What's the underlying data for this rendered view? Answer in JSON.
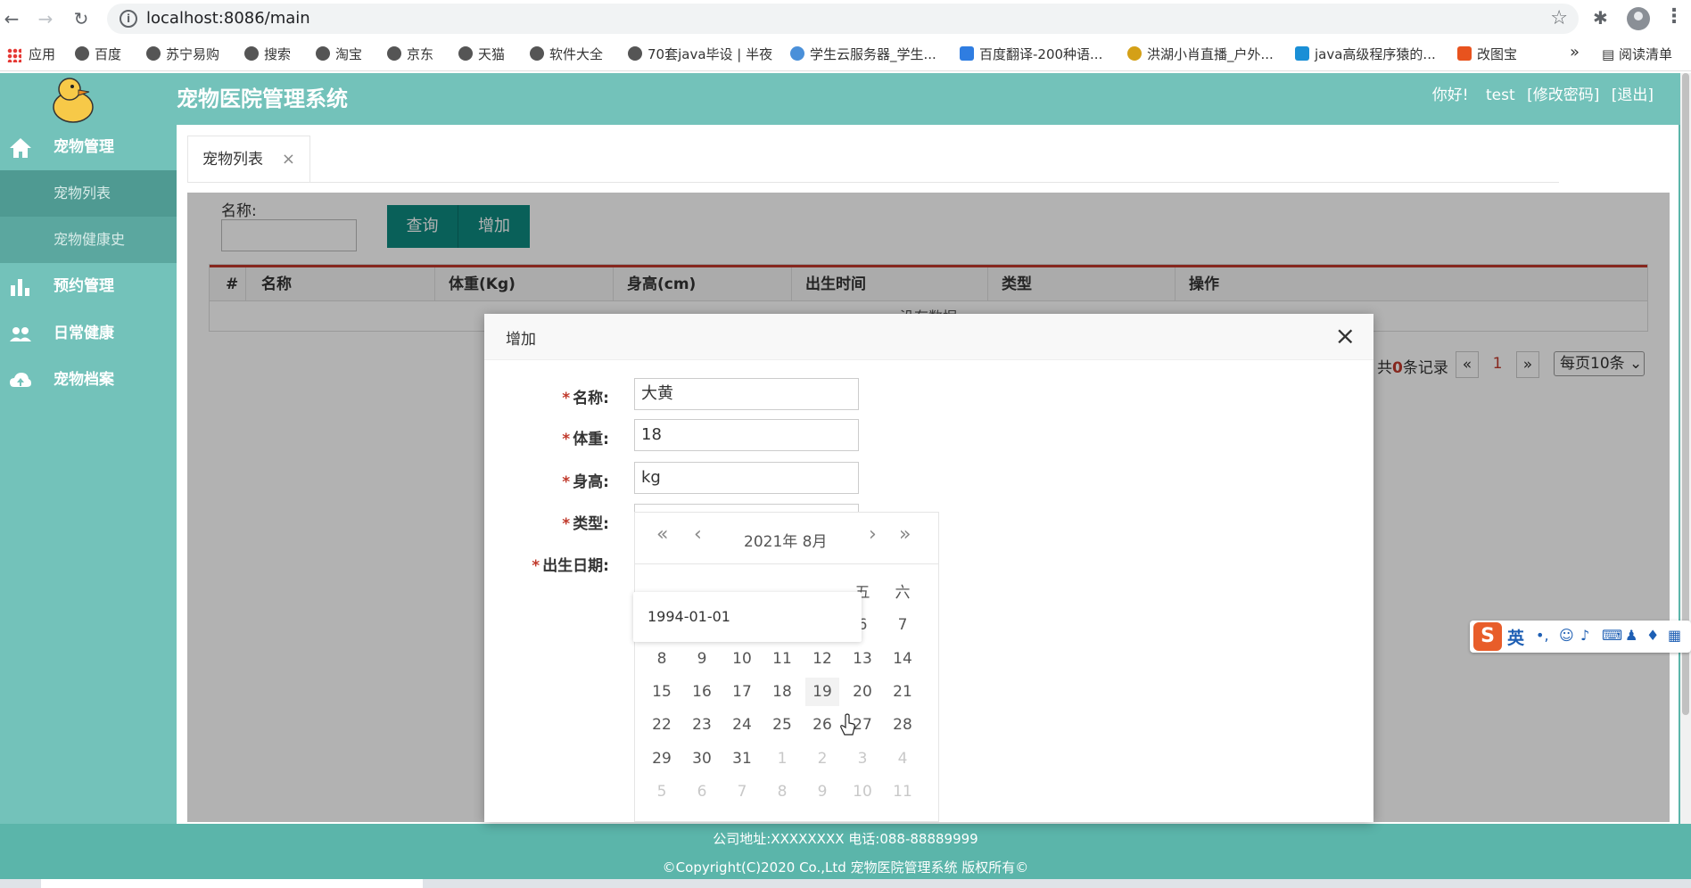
{
  "browser": {
    "url": "localhost:8086/main",
    "bookmarks": [
      "应用",
      "百度",
      "苏宁易购",
      "搜索",
      "淘宝",
      "京东",
      "天猫",
      "软件大全",
      "70套java毕设 | 半夜",
      "学生云服务器_学生...",
      "百度翻译-200种语...",
      "洪湖小肖直播_户外...",
      "java高级程序猿的...",
      "改图宝"
    ],
    "more": "»",
    "reading_list": "阅读清单"
  },
  "header": {
    "title": "宠物医院管理系统",
    "greeting": "你好!",
    "user": "test",
    "change_password": "[修改密码]",
    "logout": "[退出]"
  },
  "sidebar": {
    "items": [
      {
        "label": "宠物管理",
        "icon": "home-icon"
      },
      {
        "label": "宠物列表"
      },
      {
        "label": "宠物健康史"
      },
      {
        "label": "预约管理",
        "icon": "bar-chart-icon"
      },
      {
        "label": "日常健康",
        "icon": "people-icon"
      },
      {
        "label": "宠物档案",
        "icon": "cloud-upload-icon"
      }
    ]
  },
  "tab": {
    "label": "宠物列表",
    "close": "×"
  },
  "search": {
    "label": "名称:",
    "query_label": "查询",
    "add_label": "增加"
  },
  "table": {
    "columns": [
      "#",
      "名称",
      "体重(Kg)",
      "身高(cm)",
      "出生时间",
      "类型",
      "操作"
    ],
    "empty_text": "没有数据"
  },
  "pager": {
    "prefix": "共",
    "count": "0",
    "suffix": "条记录",
    "prev": "«",
    "page": "1",
    "next": "»",
    "page_size": "每页10条"
  },
  "modal": {
    "title": "增加",
    "close": "×",
    "required_mark": "*",
    "fields": [
      {
        "label": "名称:",
        "value": "大黄"
      },
      {
        "label": "体重:",
        "value": "18"
      },
      {
        "label": "身高:",
        "value": "kg"
      },
      {
        "label": "类型:",
        "value": ""
      },
      {
        "label": "出生日期:",
        "value": ""
      }
    ],
    "autocomplete": "1994-01-01"
  },
  "datepicker": {
    "title": "2021年  8月",
    "prev_year": "«",
    "prev_month": "‹",
    "next_month": "›",
    "next_year": "»",
    "weekday_visible": [
      "五",
      "六"
    ],
    "rows": [
      [
        "",
        "",
        "",
        "",
        "",
        "6",
        "7"
      ],
      [
        "8",
        "9",
        "10",
        "11",
        "12",
        "13",
        "14"
      ],
      [
        "15",
        "16",
        "17",
        "18",
        "19",
        "20",
        "21"
      ],
      [
        "22",
        "23",
        "24",
        "25",
        "26",
        "27",
        "28"
      ],
      [
        "29",
        "30",
        "31",
        "1",
        "2",
        "3",
        "4"
      ],
      [
        "5",
        "6",
        "7",
        "8",
        "9",
        "10",
        "11"
      ]
    ],
    "today": "19"
  },
  "ime": {
    "logo": "S",
    "mode": "英"
  },
  "footer": {
    "address": "公司地址:XXXXXXXX 电话:088-88889999",
    "copyright": "©Copyright(C)2020 Co.,Ltd 宠物医院管理系统 版权所有©"
  },
  "colors": {
    "accent": "#0d8a80",
    "sidebar": "#73c2ba",
    "danger": "#c0392b"
  }
}
